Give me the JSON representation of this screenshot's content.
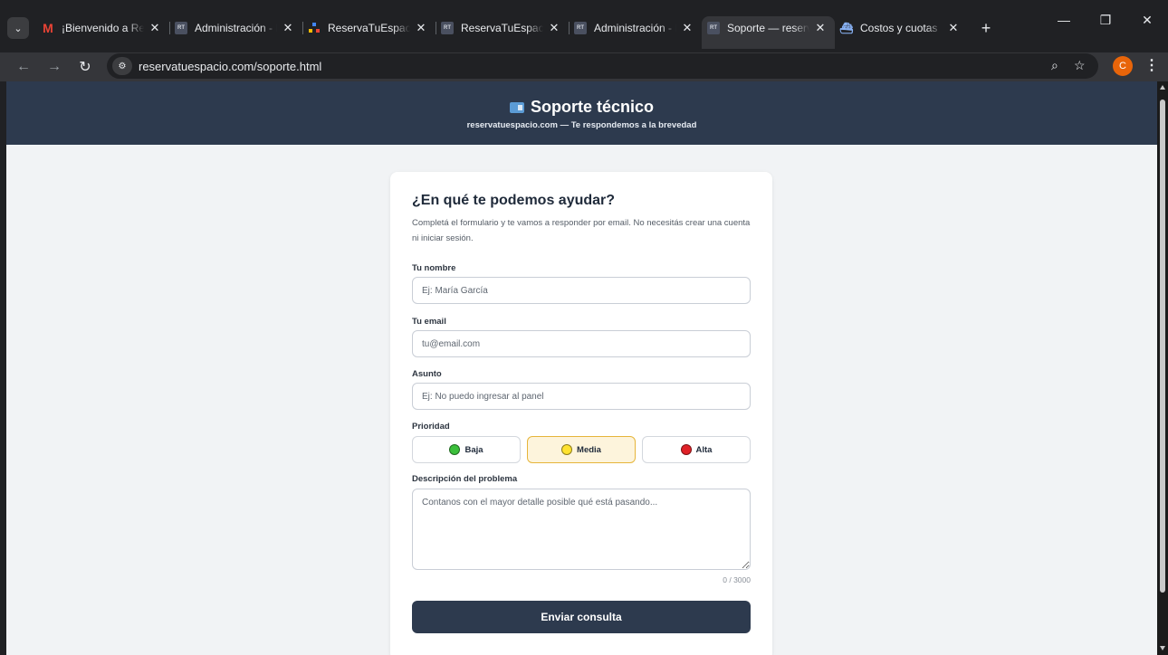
{
  "browser": {
    "tabs": [
      {
        "title": "¡Bienvenido a ReservaTuEspacio",
        "favicon": "gmail-icon",
        "active": false
      },
      {
        "title": "Administración - ReservaTuEspacio",
        "favicon": "rt-icon",
        "active": false
      },
      {
        "title": "ReservaTuEspacio",
        "favicon": "colored-dots-icon",
        "active": false
      },
      {
        "title": "ReservaTuEspacio",
        "favicon": "rt-icon",
        "active": false
      },
      {
        "title": "Administración - ReservaTuEspacio",
        "favicon": "rt-icon",
        "active": false
      },
      {
        "title": "Soporte — reservatuespacio.com",
        "favicon": "rt-icon",
        "active": true
      },
      {
        "title": "Costos y cuotas",
        "favicon": "boat-icon",
        "active": false
      }
    ],
    "tab_close_glyph": "✕",
    "new_tab_glyph": "+",
    "url": "reservatuespacio.com/soporte.html",
    "profile_initial": "C",
    "accent_profile_color": "#e8650a"
  },
  "header": {
    "title": "Soporte técnico",
    "subtitle": "reservatuespacio.com — Te respondemos a la brevedad",
    "background": "#2d3a4e"
  },
  "form": {
    "title": "¿En qué te podemos ayudar?",
    "description": "Completá el formulario y te vamos a responder por email. No necesitás crear una cuenta ni iniciar sesión.",
    "name_label": "Tu nombre",
    "name_placeholder": "Ej: María García",
    "email_label": "Tu email",
    "email_placeholder": "tu@email.com",
    "subject_label": "Asunto",
    "subject_placeholder": "Ej: No puedo ingresar al panel",
    "priority_label": "Prioridad",
    "priorities": [
      {
        "label": "Baja",
        "color": "#3bbf3b",
        "selected": false
      },
      {
        "label": "Media",
        "color": "#ffe230",
        "selected": true
      },
      {
        "label": "Alta",
        "color": "#e02127",
        "selected": false
      }
    ],
    "description_label": "Descripción del problema",
    "description_placeholder": "Contanos con el mayor detalle posible qué está pasando...",
    "char_counter": "0 / 3000",
    "submit_label": "Enviar consulta"
  }
}
